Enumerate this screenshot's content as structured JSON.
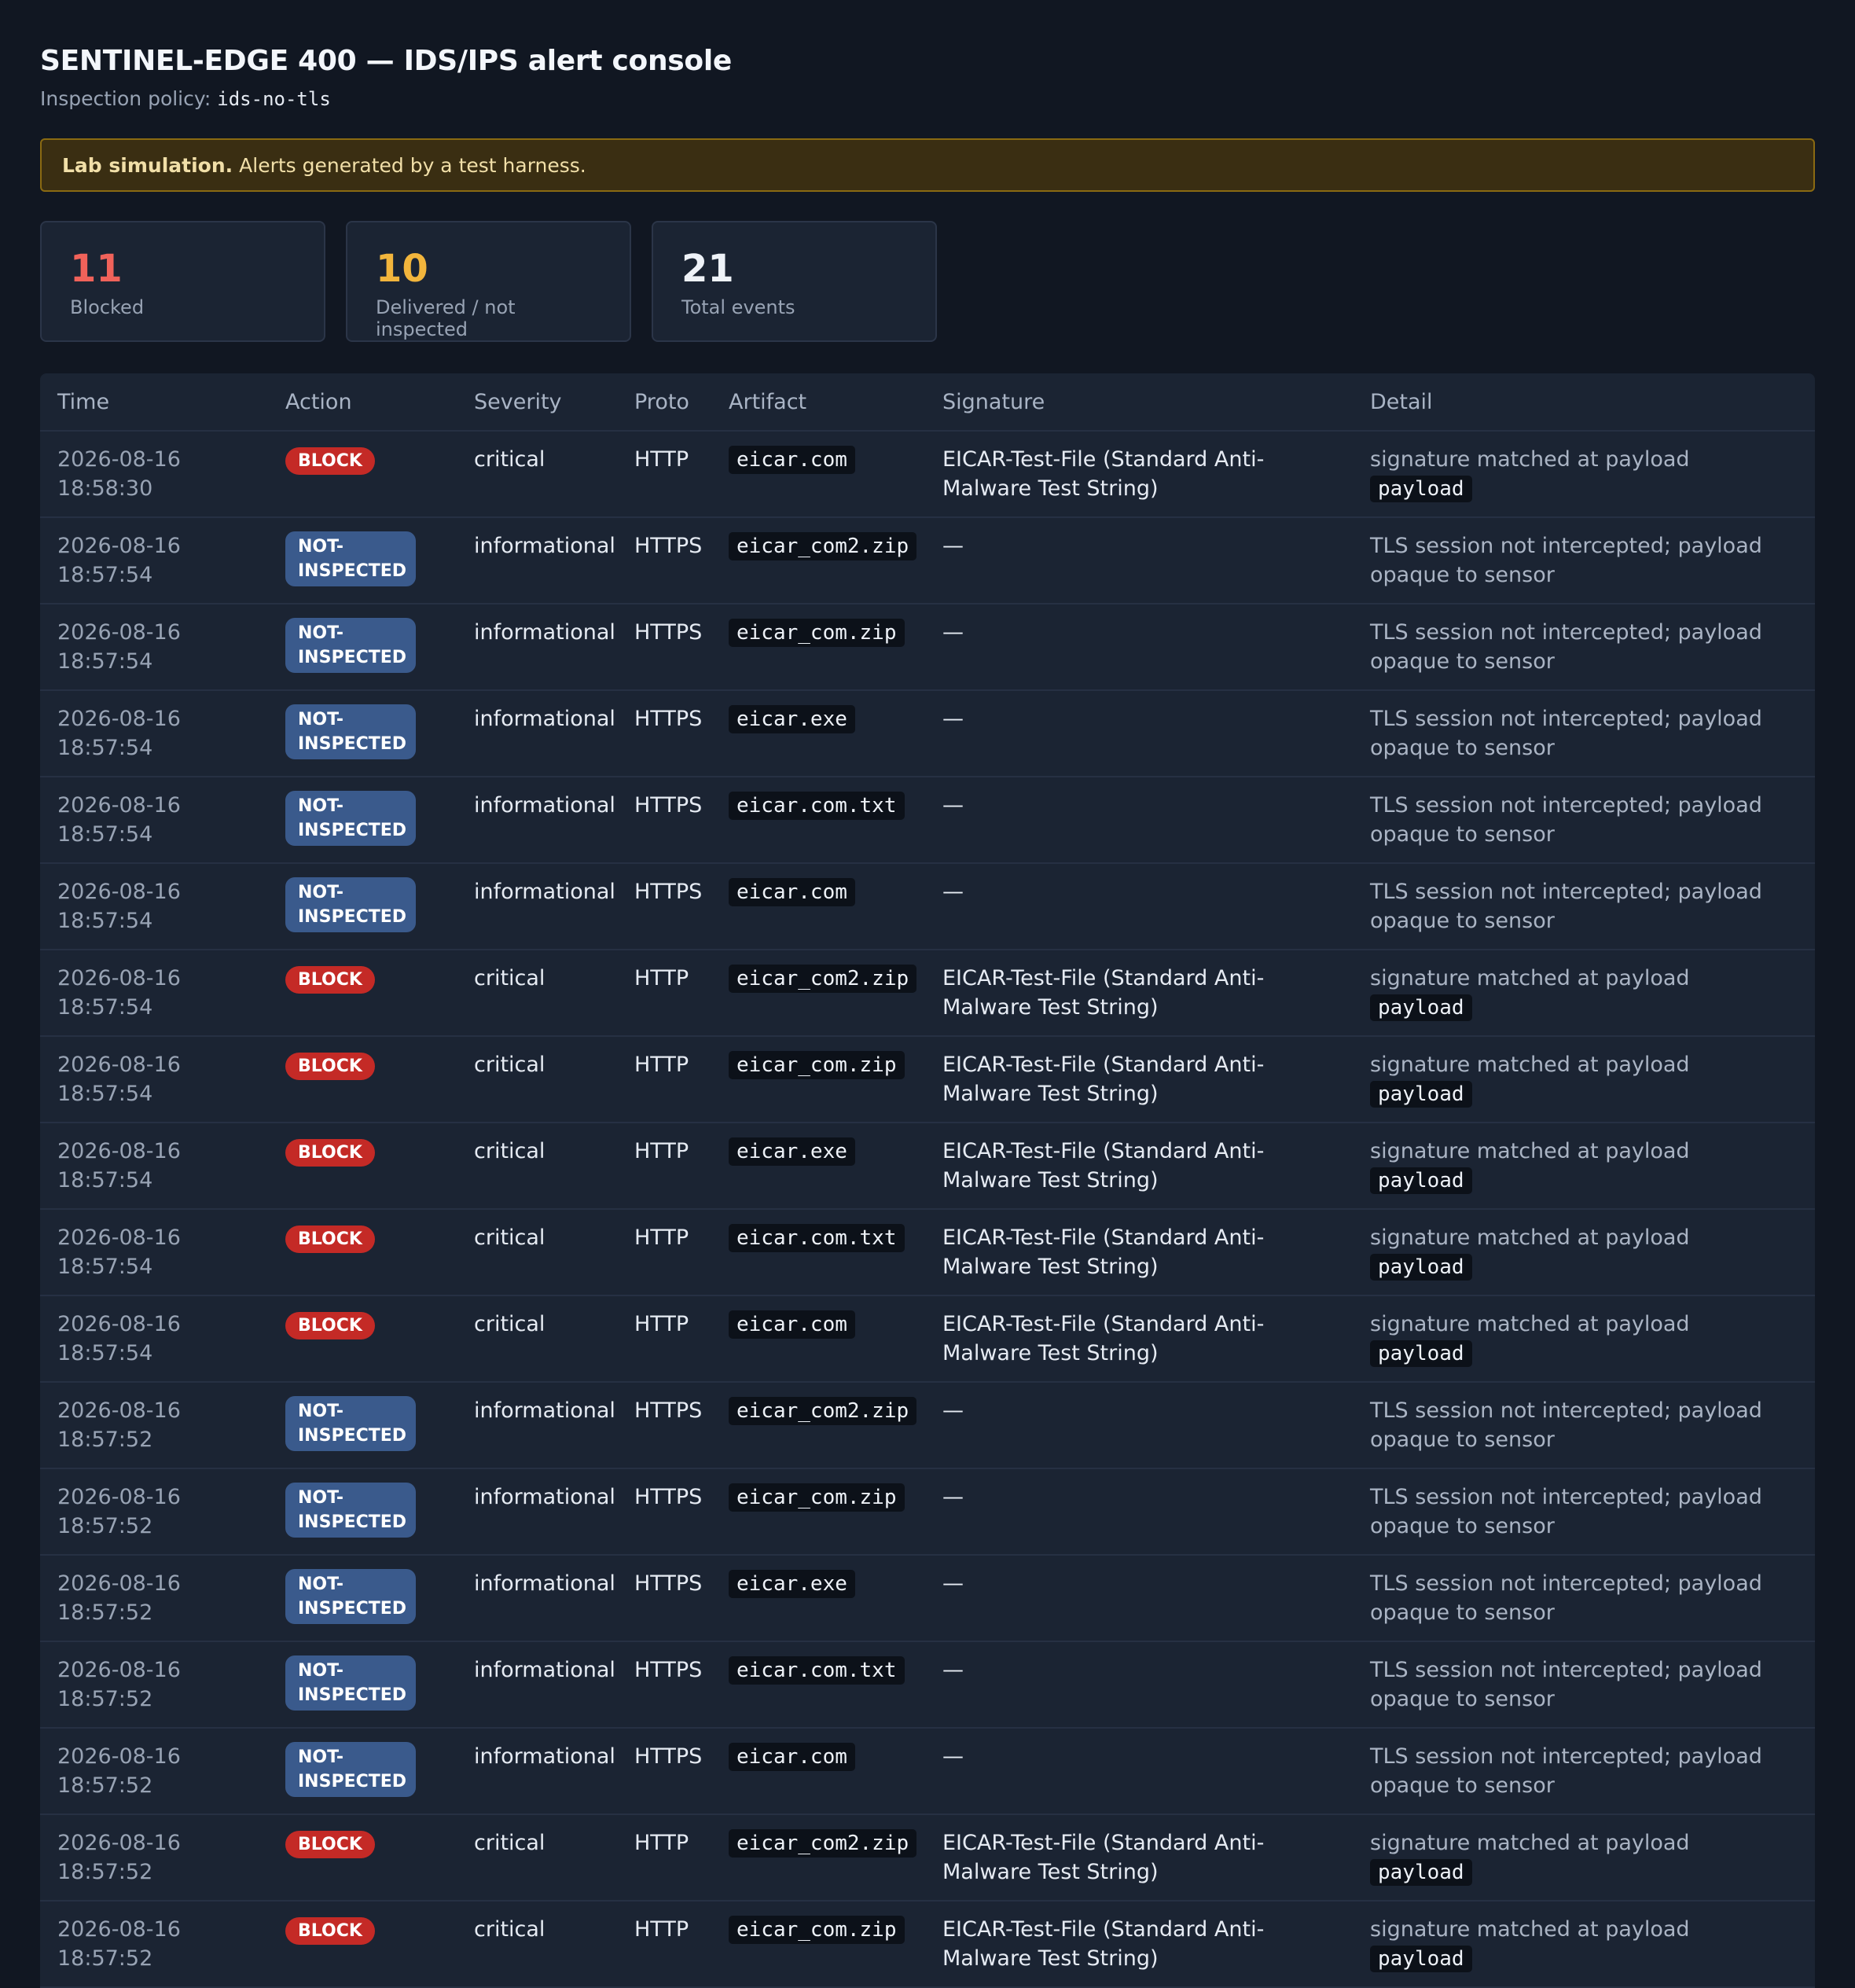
{
  "header": {
    "title": "SENTINEL-EDGE 400 — IDS/IPS alert console",
    "policy_label": "Inspection policy:",
    "policy_value": "ids-no-tls"
  },
  "banner": {
    "strong": "Lab simulation.",
    "text": "Alerts generated by a test harness."
  },
  "stats": [
    {
      "value": "11",
      "label": "Blocked",
      "color": "#f0625a"
    },
    {
      "value": "10",
      "label": "Delivered / not inspected",
      "color": "#f2b53c"
    },
    {
      "value": "21",
      "label": "Total events",
      "color": "#eef2f8"
    }
  ],
  "table": {
    "columns": [
      "Time",
      "Action",
      "Severity",
      "Proto",
      "Artifact",
      "Signature",
      "Detail"
    ],
    "rows": [
      {
        "time": "2026-08-16 18:58:30",
        "action": "BLOCK",
        "severity": "critical",
        "proto": "HTTP",
        "artifact": "eicar.com",
        "signature": "EICAR-Test-File (Standard Anti-Malware Test String)",
        "detail": "signature matched at payload",
        "detail_code": "payload"
      },
      {
        "time": "2026-08-16 18:57:54",
        "action": "NOT-INSPECTED",
        "severity": "informational",
        "proto": "HTTPS",
        "artifact": "eicar_com2.zip",
        "signature": "—",
        "detail": "TLS session not intercepted; payload opaque to sensor",
        "detail_code": ""
      },
      {
        "time": "2026-08-16 18:57:54",
        "action": "NOT-INSPECTED",
        "severity": "informational",
        "proto": "HTTPS",
        "artifact": "eicar_com.zip",
        "signature": "—",
        "detail": "TLS session not intercepted; payload opaque to sensor",
        "detail_code": ""
      },
      {
        "time": "2026-08-16 18:57:54",
        "action": "NOT-INSPECTED",
        "severity": "informational",
        "proto": "HTTPS",
        "artifact": "eicar.exe",
        "signature": "—",
        "detail": "TLS session not intercepted; payload opaque to sensor",
        "detail_code": ""
      },
      {
        "time": "2026-08-16 18:57:54",
        "action": "NOT-INSPECTED",
        "severity": "informational",
        "proto": "HTTPS",
        "artifact": "eicar.com.txt",
        "signature": "—",
        "detail": "TLS session not intercepted; payload opaque to sensor",
        "detail_code": ""
      },
      {
        "time": "2026-08-16 18:57:54",
        "action": "NOT-INSPECTED",
        "severity": "informational",
        "proto": "HTTPS",
        "artifact": "eicar.com",
        "signature": "—",
        "detail": "TLS session not intercepted; payload opaque to sensor",
        "detail_code": ""
      },
      {
        "time": "2026-08-16 18:57:54",
        "action": "BLOCK",
        "severity": "critical",
        "proto": "HTTP",
        "artifact": "eicar_com2.zip",
        "signature": "EICAR-Test-File (Standard Anti-Malware Test String)",
        "detail": "signature matched at payload",
        "detail_code": "payload"
      },
      {
        "time": "2026-08-16 18:57:54",
        "action": "BLOCK",
        "severity": "critical",
        "proto": "HTTP",
        "artifact": "eicar_com.zip",
        "signature": "EICAR-Test-File (Standard Anti-Malware Test String)",
        "detail": "signature matched at payload",
        "detail_code": "payload"
      },
      {
        "time": "2026-08-16 18:57:54",
        "action": "BLOCK",
        "severity": "critical",
        "proto": "HTTP",
        "artifact": "eicar.exe",
        "signature": "EICAR-Test-File (Standard Anti-Malware Test String)",
        "detail": "signature matched at payload",
        "detail_code": "payload"
      },
      {
        "time": "2026-08-16 18:57:54",
        "action": "BLOCK",
        "severity": "critical",
        "proto": "HTTP",
        "artifact": "eicar.com.txt",
        "signature": "EICAR-Test-File (Standard Anti-Malware Test String)",
        "detail": "signature matched at payload",
        "detail_code": "payload"
      },
      {
        "time": "2026-08-16 18:57:54",
        "action": "BLOCK",
        "severity": "critical",
        "proto": "HTTP",
        "artifact": "eicar.com",
        "signature": "EICAR-Test-File (Standard Anti-Malware Test String)",
        "detail": "signature matched at payload",
        "detail_code": "payload"
      },
      {
        "time": "2026-08-16 18:57:52",
        "action": "NOT-INSPECTED",
        "severity": "informational",
        "proto": "HTTPS",
        "artifact": "eicar_com2.zip",
        "signature": "—",
        "detail": "TLS session not intercepted; payload opaque to sensor",
        "detail_code": ""
      },
      {
        "time": "2026-08-16 18:57:52",
        "action": "NOT-INSPECTED",
        "severity": "informational",
        "proto": "HTTPS",
        "artifact": "eicar_com.zip",
        "signature": "—",
        "detail": "TLS session not intercepted; payload opaque to sensor",
        "detail_code": ""
      },
      {
        "time": "2026-08-16 18:57:52",
        "action": "NOT-INSPECTED",
        "severity": "informational",
        "proto": "HTTPS",
        "artifact": "eicar.exe",
        "signature": "—",
        "detail": "TLS session not intercepted; payload opaque to sensor",
        "detail_code": ""
      },
      {
        "time": "2026-08-16 18:57:52",
        "action": "NOT-INSPECTED",
        "severity": "informational",
        "proto": "HTTPS",
        "artifact": "eicar.com.txt",
        "signature": "—",
        "detail": "TLS session not intercepted; payload opaque to sensor",
        "detail_code": ""
      },
      {
        "time": "2026-08-16 18:57:52",
        "action": "NOT-INSPECTED",
        "severity": "informational",
        "proto": "HTTPS",
        "artifact": "eicar.com",
        "signature": "—",
        "detail": "TLS session not intercepted; payload opaque to sensor",
        "detail_code": ""
      },
      {
        "time": "2026-08-16 18:57:52",
        "action": "BLOCK",
        "severity": "critical",
        "proto": "HTTP",
        "artifact": "eicar_com2.zip",
        "signature": "EICAR-Test-File (Standard Anti-Malware Test String)",
        "detail": "signature matched at payload",
        "detail_code": "payload"
      },
      {
        "time": "2026-08-16 18:57:52",
        "action": "BLOCK",
        "severity": "critical",
        "proto": "HTTP",
        "artifact": "eicar_com.zip",
        "signature": "EICAR-Test-File (Standard Anti-Malware Test String)",
        "detail": "signature matched at payload",
        "detail_code": "payload"
      }
    ]
  }
}
